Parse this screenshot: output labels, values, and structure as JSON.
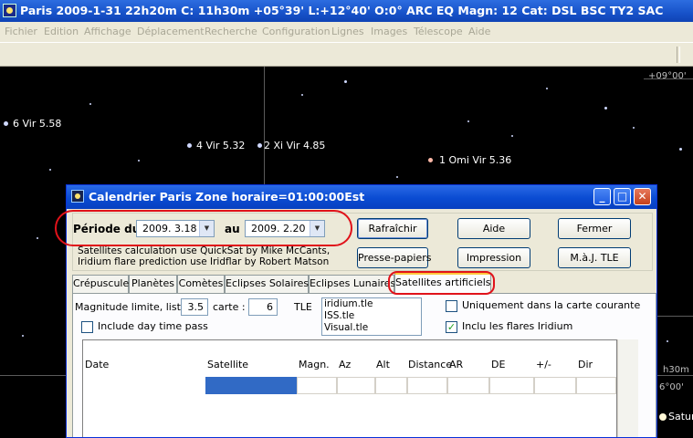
{
  "window": {
    "title": "Paris 2009-1-31  22h20m C: 11h30m +05°39' L:+12°40' O:0°  ARC EQ Magn: 12 Cat: DSL BSC TY2 SAC"
  },
  "menu": [
    "Fichier",
    "Edition",
    "Affichage",
    "Déplacement",
    "Recherche",
    "Configuration",
    "Lignes",
    "Images",
    "Télescope",
    "Aide"
  ],
  "sky": {
    "stars": [
      {
        "label": "6 Vir 5.58"
      },
      {
        "label": "4 Vir 5.32"
      },
      {
        "label": "2 Xi Vir 4.85"
      },
      {
        "label": "1 Omi Vir 5.36"
      },
      {
        "label": "Satur"
      }
    ],
    "grid_labels": [
      "+09°00'",
      "h30m",
      "6°00'"
    ]
  },
  "dialog": {
    "title": "Calendrier Paris Zone horaire=01:00:00Est",
    "period_label": "Période du",
    "date_from": "2009. 3.18",
    "au_label": "au",
    "date_to": "2009. 2.20",
    "buttons": {
      "refresh": "Rafraîchir",
      "help": "Aide",
      "close": "Fermer",
      "clipboard": "Presse-papiers",
      "print": "Impression",
      "update_tle": "M.à.J. TLE"
    },
    "info_line1": "Satellites calculation use QuickSat by Mike McCants,",
    "info_line2": "Iridium flare prediction use Iridflar by Robert Matson",
    "tabs": [
      "Crépuscule",
      "Planètes",
      "Comètes",
      "Eclipses Solaires",
      "Eclipses Lunaires",
      "Satellites artificiels"
    ],
    "active_tab": "Satellites artificiels",
    "magnitude_label": "Magnitude limite, liste :",
    "magnitude_value": "3.5",
    "carte_label": "carte :",
    "carte_value": "6",
    "tle_label": "TLE",
    "tle_files": [
      "iridium.tle",
      "ISS.tle",
      "Visual.tle"
    ],
    "include_day": {
      "label": "Include day time pass",
      "checked": false
    },
    "only_chart": {
      "label": "Uniquement dans la carte courante",
      "checked": false
    },
    "include_flares": {
      "label": "Inclu les flares Iridium",
      "checked": true
    },
    "columns": [
      "Date",
      "Satellite",
      "Magn.",
      "Az",
      "Alt",
      "Distance",
      "AR",
      "DE",
      "+/-",
      "Dir"
    ]
  },
  "colors": {
    "title_blue": "#1752c9",
    "highlight_red": "#e0121a",
    "selection_blue": "#316ac5"
  }
}
